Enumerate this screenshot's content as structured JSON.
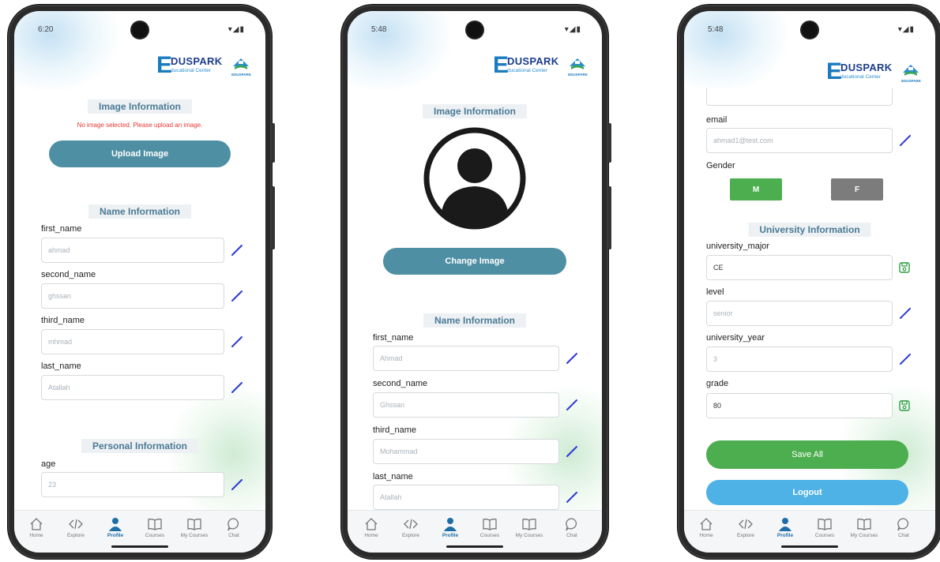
{
  "screens": [
    {
      "status_time": "6:20",
      "logo": {
        "word": "DUSPARK",
        "sub": "ducational Center",
        "emblem_label": "EDUSPARK"
      },
      "image_section_title": "Image Information",
      "image_warning": "No image selected. Please upload an image.",
      "upload_button": "Upload Image",
      "name_section_title": "Name Information",
      "fields": [
        {
          "label": "first_name",
          "value": "ahmad"
        },
        {
          "label": "second_name",
          "value": "ghssan"
        },
        {
          "label": "third_name",
          "value": "mhmad"
        },
        {
          "label": "last_name",
          "value": "Atallah"
        }
      ],
      "personal_section_title": "Personal Information",
      "age_label": "age",
      "age_value": "23"
    },
    {
      "status_time": "5:48",
      "logo": {
        "word": "DUSPARK",
        "sub": "ducational Center",
        "emblem_label": "EDUSPARK"
      },
      "image_section_title": "Image Information",
      "change_button": "Change Image",
      "name_section_title": "Name Information",
      "fields": [
        {
          "label": "first_name",
          "value": "Ahmad"
        },
        {
          "label": "second_name",
          "value": "Ghssan"
        },
        {
          "label": "third_name",
          "value": "Mohammad"
        },
        {
          "label": "last_name",
          "value": "Atallah"
        }
      ]
    },
    {
      "status_time": "5:48",
      "logo": {
        "word": "DUSPARK",
        "sub": "ducational Center",
        "emblem_label": "EDUSPARK"
      },
      "email_label": "email",
      "email_value": "ahmad1@test.com",
      "gender_label": "Gender",
      "gender_m": "M",
      "gender_f": "F",
      "university_section_title": "University Information",
      "fields": [
        {
          "label": "university_major",
          "value": "CE",
          "mode": "save"
        },
        {
          "label": "level",
          "value": "senior",
          "mode": "edit"
        },
        {
          "label": "university_year",
          "value": "3",
          "mode": "edit"
        },
        {
          "label": "grade",
          "value": "80",
          "mode": "save"
        }
      ],
      "save_all_button": "Save All",
      "logout_button": "Logout"
    }
  ],
  "nav": [
    "Home",
    "Explore",
    "Profile",
    "Courses",
    "My Courses",
    "Chat"
  ],
  "nav_active": "Profile",
  "colors": {
    "accent_teal": "#4e8fa4",
    "section_title": "#4a7a96",
    "edit_icon": "#2d3ad6",
    "save_icon": "#2e9e44",
    "gender_active": "#4cae4f",
    "gender_inactive": "#7c7c7c",
    "save_all": "#4cae4f",
    "logout": "#4fb2e6",
    "warning": "#e53935",
    "nav_active": "#1e6ea8"
  }
}
